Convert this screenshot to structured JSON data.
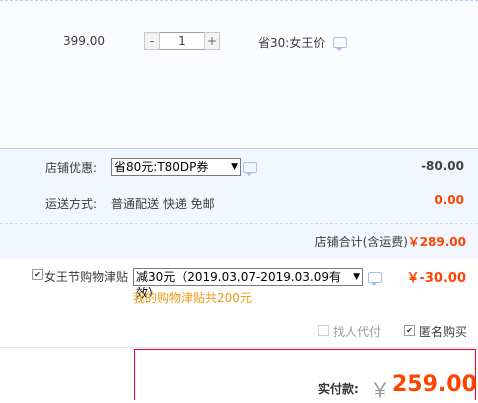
{
  "item": {
    "price": "399.00",
    "quantity": "1",
    "decrement": "-",
    "increment": "+",
    "saving_text": "省30:女王价"
  },
  "shop": {
    "coupon_label": "店铺优惠:",
    "coupon_selected": "省80元:T80DP券",
    "coupon_amount": "-80.00",
    "shipping_label": "运送方式:",
    "shipping_option": "普通配送 快递 免邮",
    "shipping_amount": "0.00",
    "subtotal_label": "店铺合计(含运费)",
    "subtotal_amount": "￥289.00"
  },
  "promo": {
    "checkbox_checked": "✔",
    "label": "女王节购物津贴",
    "selected": "减30元（2019.03.07-2019.03.09有效）",
    "amount": "￥-30.00",
    "note": "我的购物津贴共200元"
  },
  "options": {
    "proxy_pay_label": "找人代付",
    "anonymous_label": "匿名购买",
    "anonymous_checked": "✔"
  },
  "total": {
    "label": "实付款:",
    "currency": "￥",
    "amount": "259.00"
  },
  "colors": {
    "accent_red": "#ff4400",
    "border_red": "#ff0036",
    "light_blue_bg": "#f2f7ff",
    "note_orange": "#e99a17"
  }
}
